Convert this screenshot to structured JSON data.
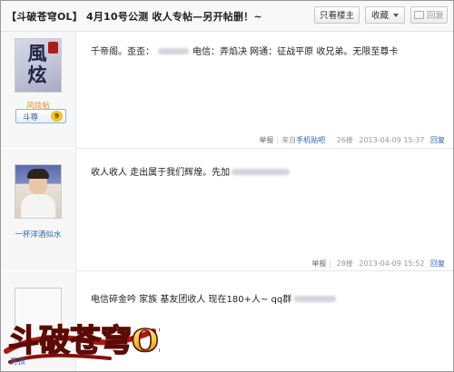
{
  "header": {
    "title": "【斗破苍穹OL】 4月10号公测  收人专帖—另开帖删！~",
    "only_op_label": "只看楼主",
    "collect_label": "收藏",
    "reply_label": "回复"
  },
  "posts": [
    {
      "author": "风炫帖",
      "avatar_text": "風炫",
      "badge_label": "斗尊",
      "badge_level": "9",
      "content_a": "千帝阁。歪歪：",
      "content_b": "电信：弄焰决  网通：征战平原  收兄弟。无限至尊卡",
      "report": "举报",
      "source": "来自",
      "source_app": "手机贴吧",
      "floor": "26楼",
      "time": "2013-04-09 15:37",
      "reply": "回复"
    },
    {
      "author": "一杯洋酒似水",
      "content_a": "收人收人  走出属于我们辉煌。先加",
      "report": "举报",
      "floor": "28楼",
      "time": "2013-04-09 15:52",
      "reply": "回复"
    },
    {
      "author": "男孩",
      "content_a": "电信碎金吟  家族  基友团收人  现在180+人~ qq群"
    }
  ],
  "logo": {
    "text": "斗破苍穹OL",
    "colors": {
      "gold": "#f0c63a",
      "red": "#b3150f",
      "outline": "#5a0b05"
    }
  },
  "colors": {
    "link": "#2d64b3",
    "meta": "#999999",
    "badge": "#f3c31f"
  }
}
